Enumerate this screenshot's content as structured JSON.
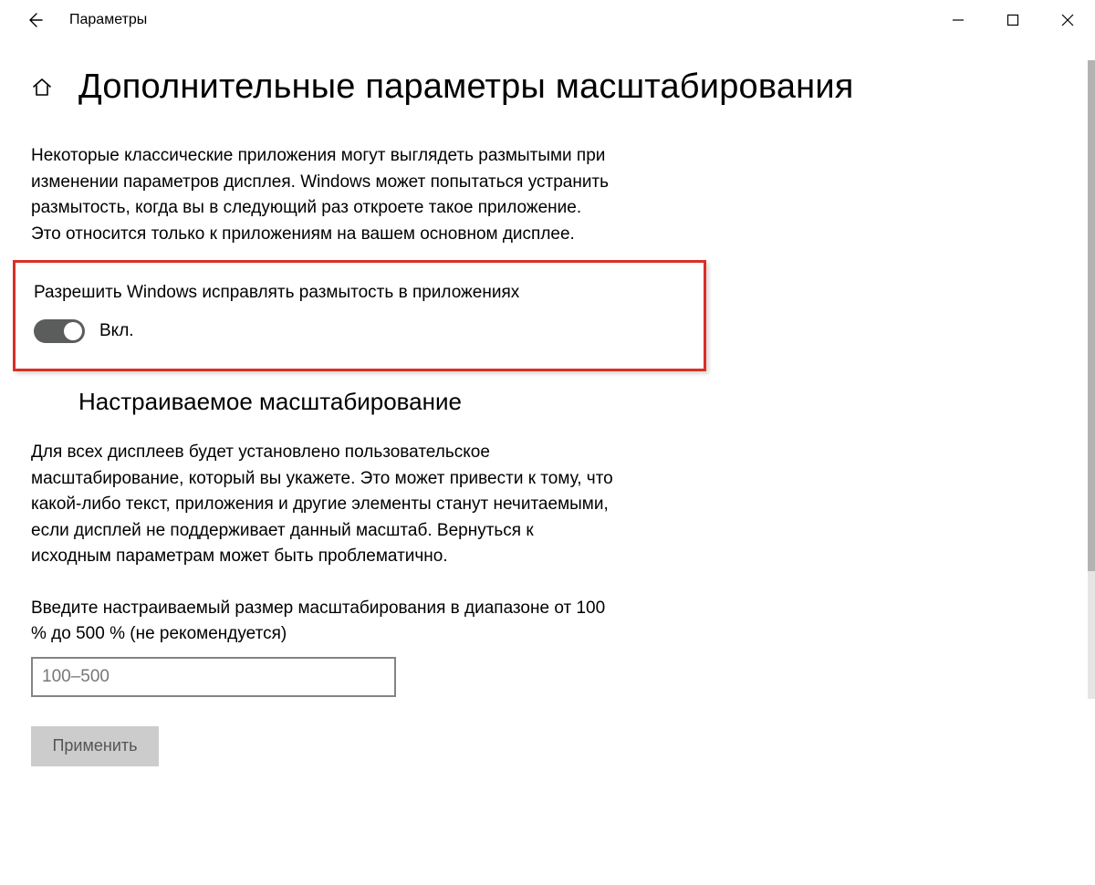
{
  "window": {
    "title": "Параметры"
  },
  "page": {
    "title": "Дополнительные параметры масштабирования",
    "intro": "Некоторые классические приложения могут выглядеть размытыми при изменении параметров дисплея. Windows может попытаться устранить размытость, когда вы в следующий раз откроете такое приложение. Это относится только к приложениям на вашем основном дисплее."
  },
  "fixBlur": {
    "label": "Разрешить Windows исправлять размытость в приложениях",
    "state": "Вкл.",
    "on": true
  },
  "customScaling": {
    "heading": "Настраиваемое масштабирование",
    "desc": "Для всех дисплеев будет установлено пользовательское масштабирование, который вы укажете. Это может привести к тому, что какой-либо текст, приложения и другие элементы станут нечитаемыми, если дисплей не поддерживает данный масштаб. Вернуться к исходным параметрам может быть проблематично.",
    "inputLabel": "Введите настраиваемый размер масштабирования в диапазоне от 100 % до 500 % (не рекомендуется)",
    "placeholder": "100–500",
    "applyLabel": "Применить"
  }
}
